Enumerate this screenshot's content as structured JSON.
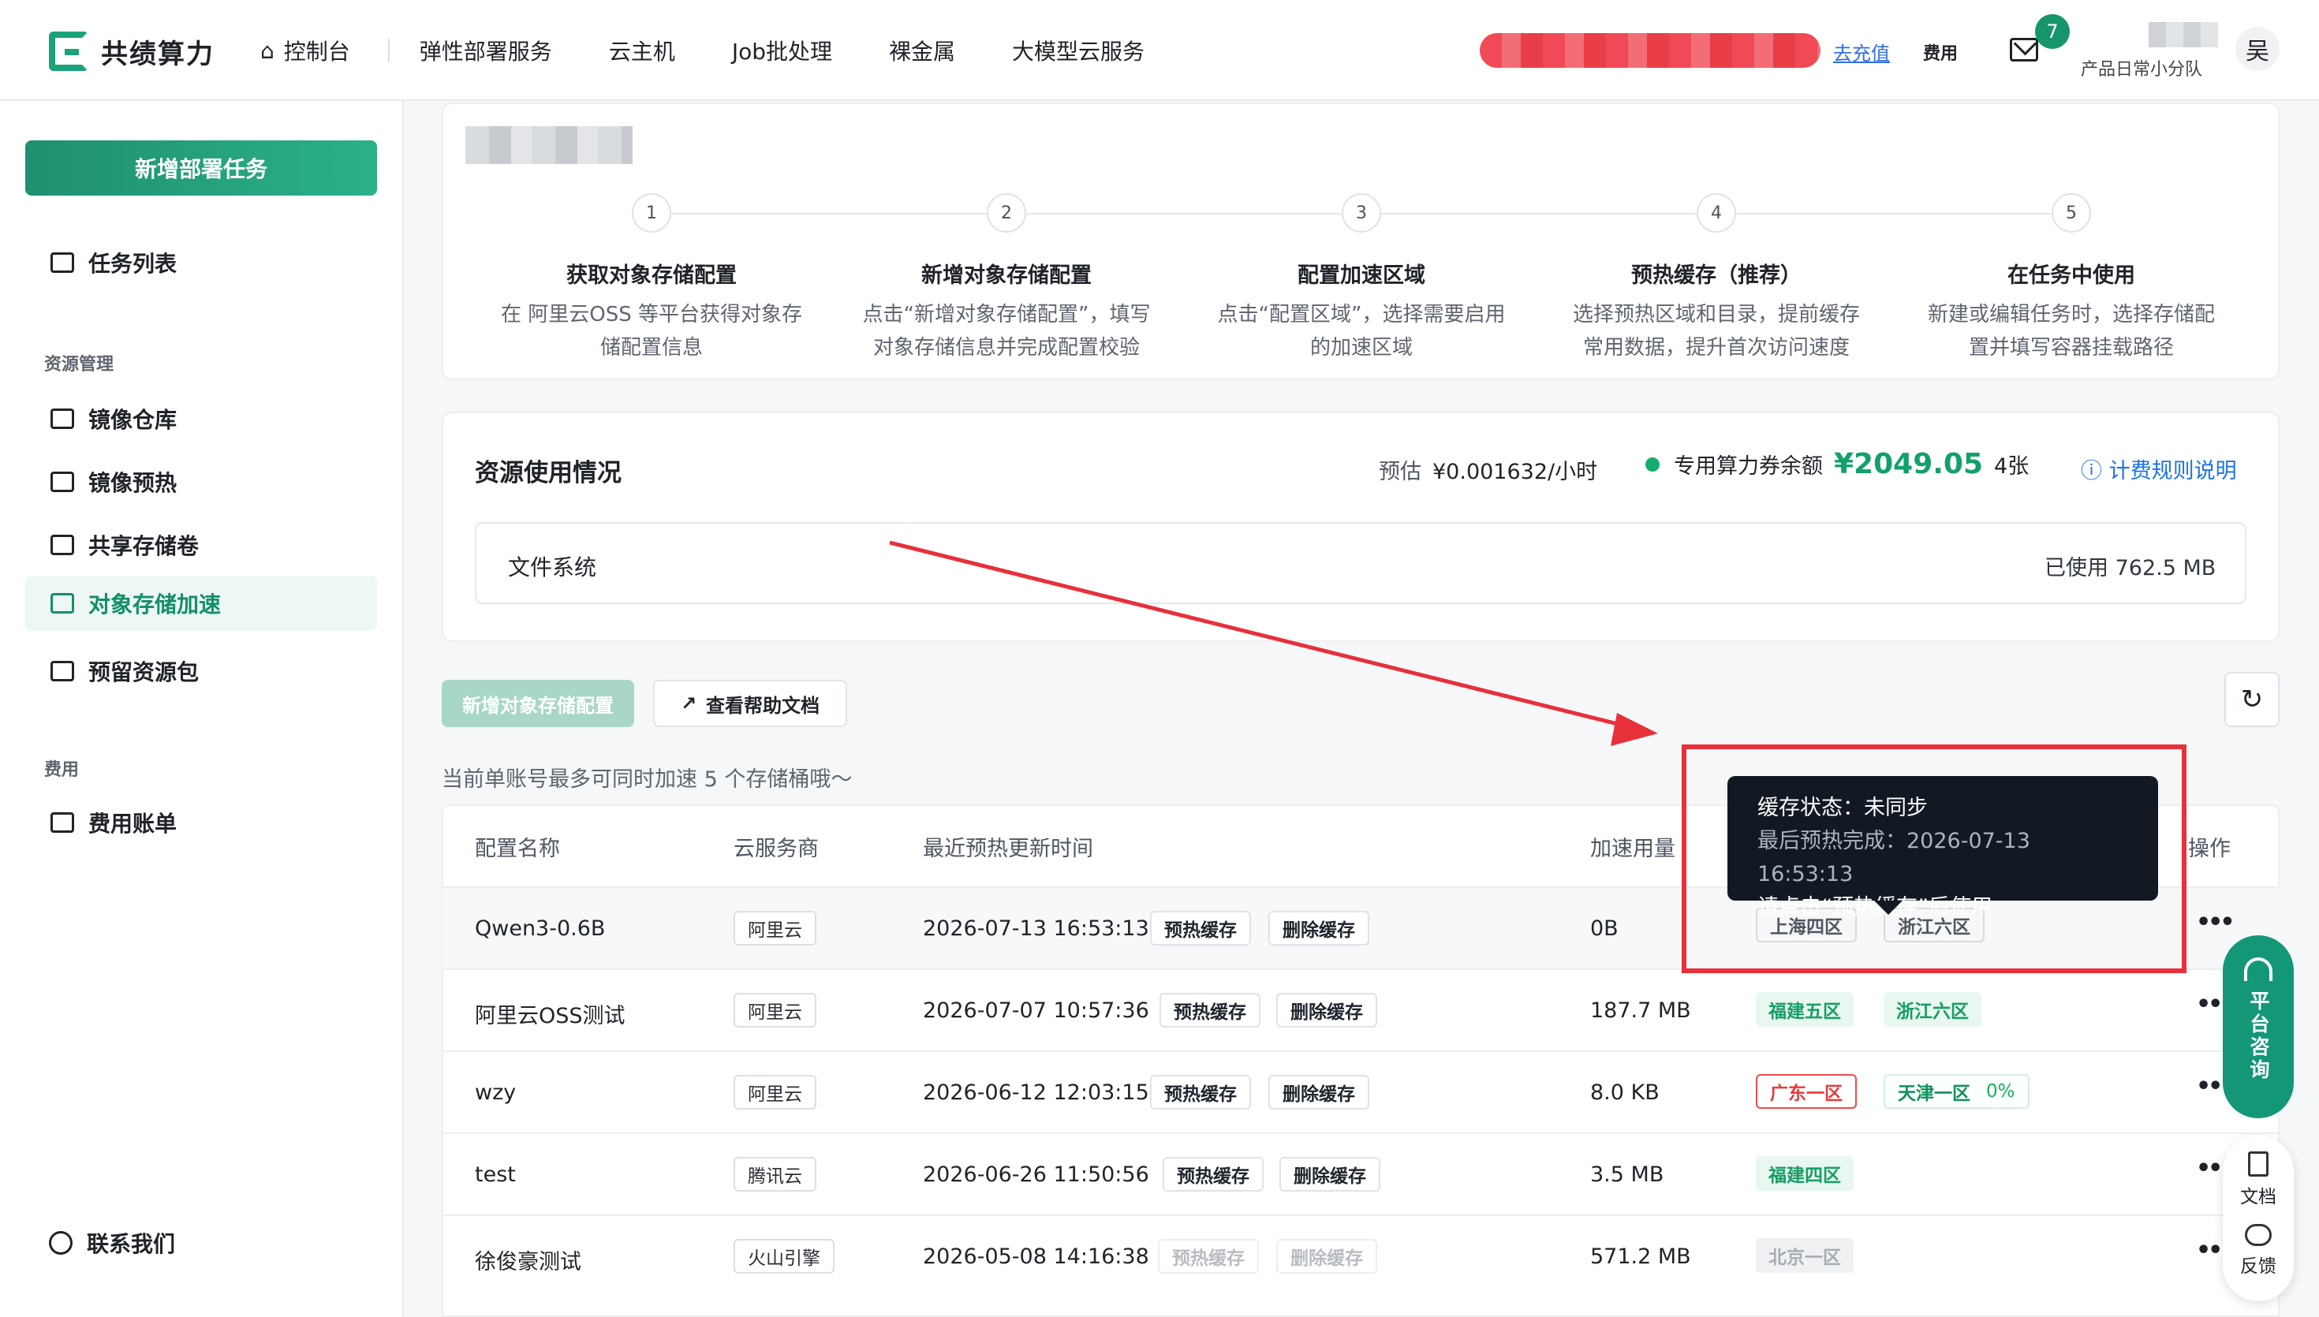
{
  "brand": {
    "name": "共绩算力",
    "accent": "#1AA37A"
  },
  "nav": [
    "控制台",
    "弹性部署服务",
    "云主机",
    "Job批处理",
    "裸金属",
    "大模型云服务"
  ],
  "header": {
    "recharge": "去充值",
    "fee": "费用",
    "mail_badge": "7",
    "team": "产品日常小分队",
    "avatar": "吴"
  },
  "sidebar": {
    "new_task": "新增部署任务",
    "task_list": "任务列表",
    "resource_group": "资源管理",
    "items": [
      "镜像仓库",
      "镜像预热",
      "共享存储卷",
      "对象存储加速",
      "预留资源包"
    ],
    "fee_group": "费用",
    "bill": "费用账单",
    "contact": "联系我们"
  },
  "steps": [
    {
      "num": "1",
      "title": "获取对象存储配置",
      "desc1": "在 阿里云OSS 等平台获得对象存",
      "desc2": "储配置信息"
    },
    {
      "num": "2",
      "title": "新增对象存储配置",
      "desc1": "点击“新增对象存储配置”，填写",
      "desc2": "对象存储信息并完成配置校验"
    },
    {
      "num": "3",
      "title": "配置加速区域",
      "desc1": "点击“配置区域”，选择需要启用",
      "desc2": "的加速区域"
    },
    {
      "num": "4",
      "title": "预热缓存（推荐）",
      "desc1": "选择预热区域和目录，提前缓存",
      "desc2": "常用数据，提升首次访问速度"
    },
    {
      "num": "5",
      "title": "在任务中使用",
      "desc1": "新建或编辑任务时，选择存储配",
      "desc2": "置并填写容器挂载路径"
    }
  ],
  "resource": {
    "title": "资源使用情况",
    "estimate_label": "预估",
    "estimate_value": "¥0.001632/小时",
    "coupon_label": "专用算力券余额",
    "coupon_value": "¥2049.05",
    "coupon_count": "4张",
    "billing_rules": "计费规则说明",
    "fs_label": "文件系统",
    "fs_used": "已使用 762.5 MB"
  },
  "toolbar": {
    "add_config": "新增对象存储配置",
    "help_doc": "查看帮助文档",
    "refresh": "↻",
    "note": "当前单账号最多可同时加速 5 个存储桶哦～"
  },
  "table": {
    "headers": [
      "配置名称",
      "云服务商",
      "最近预热更新时间",
      "加速用量",
      "操作"
    ],
    "rows": [
      {
        "name": "Qwen3-0.6B",
        "vendor": "阿里云",
        "time": "2026-07-13 16:53:13",
        "warm": "预热缓存",
        "delete": "删除缓存",
        "usage": "0B",
        "regions": [
          {
            "label": "上海四区",
            "style": "gray"
          },
          {
            "label": "浙江六区",
            "style": "gray"
          }
        ]
      },
      {
        "name": "阿里云OSS测试",
        "vendor": "阿里云",
        "time": "2026-07-07 10:57:36",
        "warm": "预热缓存",
        "delete": "删除缓存",
        "usage": "187.7 MB",
        "regions": [
          {
            "label": "福建五区",
            "style": "green"
          },
          {
            "label": "浙江六区",
            "style": "green"
          }
        ]
      },
      {
        "name": "wzy",
        "vendor": "阿里云",
        "time": "2026-06-12 12:03:15",
        "warm": "预热缓存",
        "delete": "删除缓存",
        "usage": "8.0 KB",
        "regions": [
          {
            "label": "广东一区",
            "style": "red"
          },
          {
            "label": "天津一区",
            "extra": "0%",
            "style": "green-outline"
          }
        ]
      },
      {
        "name": "test",
        "vendor": "腾讯云",
        "time": "2026-06-26 11:50:56",
        "warm": "预热缓存",
        "delete": "删除缓存",
        "usage": "3.5 MB",
        "regions": [
          {
            "label": "福建四区",
            "style": "green"
          }
        ]
      },
      {
        "name": "徐俊豪测试",
        "vendor": "火山引擎",
        "time": "2026-05-08 14:16:38",
        "warm": "预热缓存",
        "delete": "删除缓存",
        "usage": "571.2 MB",
        "regions": [
          {
            "label": "北京一区",
            "style": "disabled"
          }
        ]
      }
    ]
  },
  "tooltip": {
    "line1": "缓存状态：未同步",
    "line2": "最后预热完成：2026-07-13 16:53:13",
    "line3": "请点击“预热缓存”后使用"
  },
  "floating": {
    "consult": "平台咨询",
    "docs": "文档",
    "feedback": "反馈"
  },
  "icons": [
    "home-icon",
    "mail-icon",
    "list-icon",
    "cube-icon",
    "copy-icon",
    "upload-icon",
    "cloud-icon",
    "box-icon",
    "card-icon",
    "help-icon",
    "info-icon",
    "external-link-icon",
    "refresh-icon",
    "more-icon",
    "headset-icon",
    "doc-icon",
    "chat-icon"
  ]
}
